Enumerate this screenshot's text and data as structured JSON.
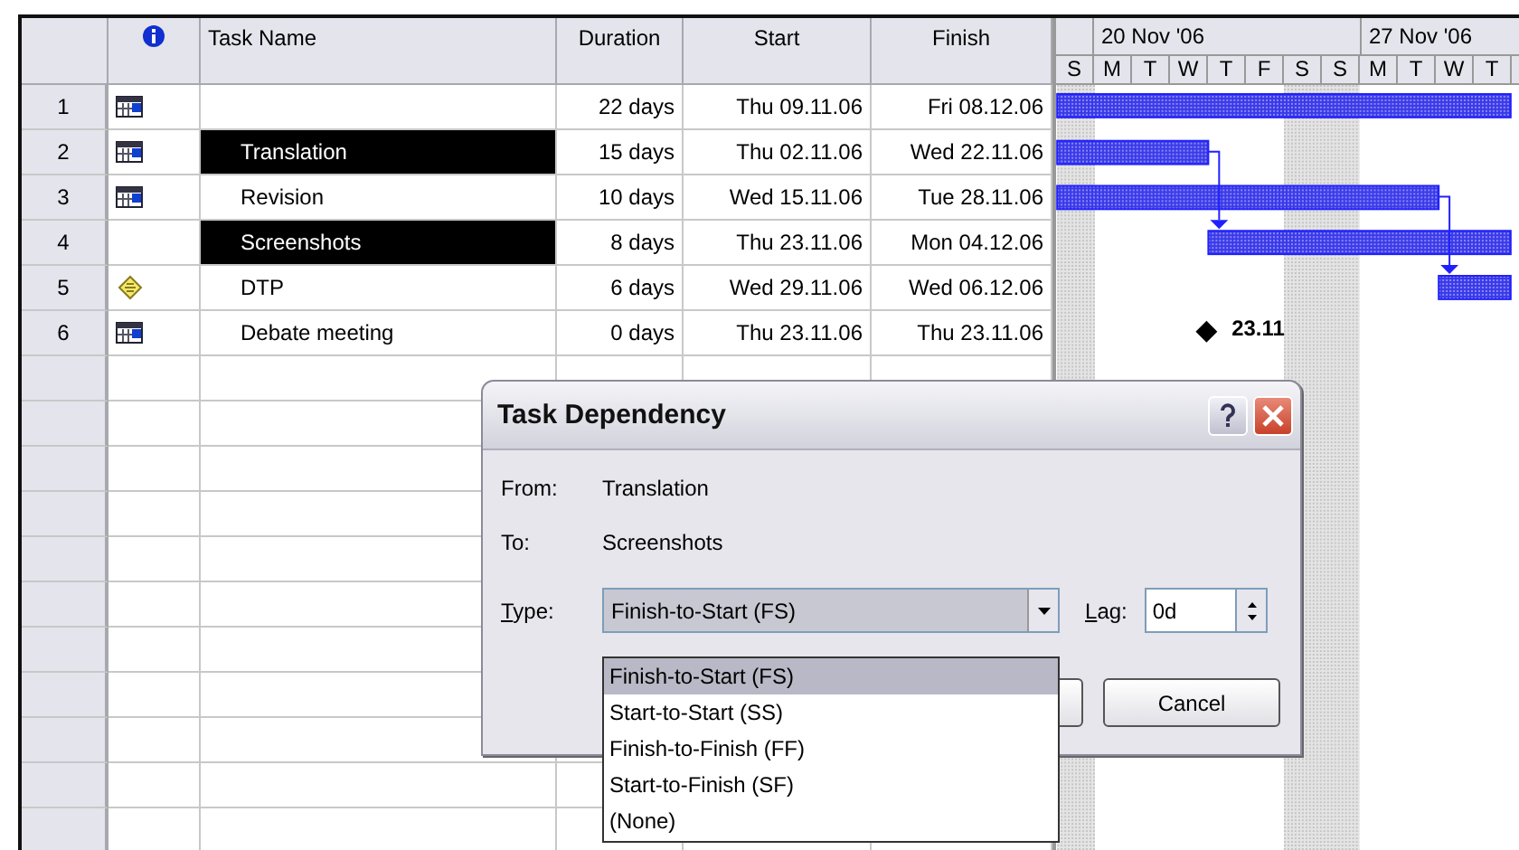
{
  "table": {
    "columns": [
      "Task Name",
      "Duration",
      "Start",
      "Finish"
    ],
    "rows": [
      {
        "id": "1",
        "kind": "calendar",
        "duration": "22 days",
        "start": "Thu 09.11.06",
        "finish": "Fri 08.12.06",
        "selected": false
      },
      {
        "id": "2",
        "kind": "calendar",
        "name": "Translation",
        "duration": "15 days",
        "start": "Thu 02.11.06",
        "finish": "Wed 22.11.06",
        "selected": true
      },
      {
        "id": "3",
        "kind": "calendar",
        "name": "Revision",
        "duration": "10 days",
        "start": "Wed 15.11.06",
        "finish": "Tue 28.11.06",
        "selected": false
      },
      {
        "id": "4",
        "kind": "plain",
        "name": "Screenshots",
        "duration": "8 days",
        "start": "Thu 23.11.06",
        "finish": "Mon 04.12.06",
        "selected": true
      },
      {
        "id": "5",
        "kind": "note",
        "name": "DTP",
        "duration": "6 days",
        "start": "Wed 29.11.06",
        "finish": "Wed 06.12.06",
        "selected": false
      },
      {
        "id": "6",
        "kind": "calendar",
        "name": "Debate meeting",
        "duration": "0 days",
        "start": "Thu 23.11.06",
        "finish": "Thu 23.11.06",
        "selected": false
      }
    ]
  },
  "gantt": {
    "weeks": [
      "20 Nov '06",
      "27 Nov '06"
    ],
    "days": [
      "S",
      "M",
      "T",
      "W",
      "T",
      "F",
      "S",
      "S",
      "M",
      "T",
      "W",
      "T"
    ],
    "milestone_label": "23.11"
  },
  "dialog": {
    "title": "Task Dependency",
    "from_label": "From:",
    "from_value": "Translation",
    "to_label": "To:",
    "to_value": "Screenshots",
    "type_label": "Type:",
    "type_value": "Finish-to-Start (FS)",
    "lag_label": "Lag:",
    "lag_value": "0d",
    "cancel": "Cancel",
    "options": [
      {
        "label": "Finish-to-Start (FS)",
        "selected": true
      },
      {
        "label": "Start-to-Start (SS)",
        "selected": false
      },
      {
        "label": "Finish-to-Finish (FF)",
        "selected": false
      },
      {
        "label": "Start-to-Finish (SF)",
        "selected": false
      },
      {
        "label": "(None)",
        "selected": false
      }
    ]
  }
}
